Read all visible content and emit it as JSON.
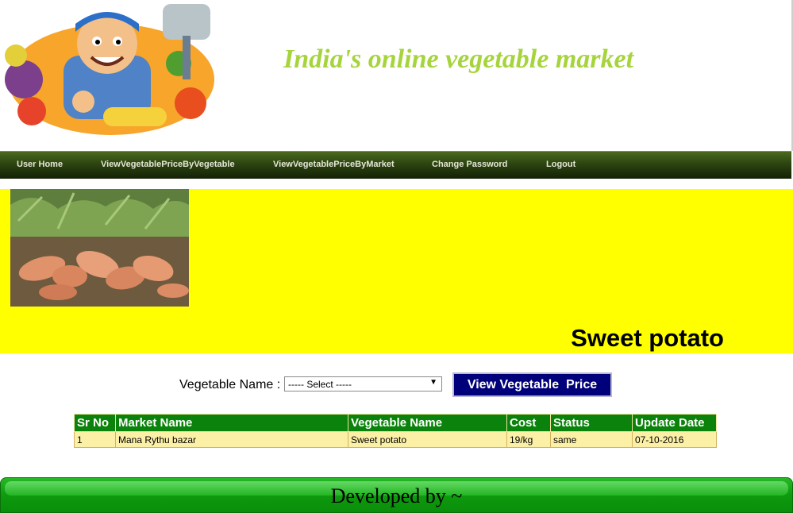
{
  "header": {
    "title": "India's online vegetable market"
  },
  "nav": {
    "items": [
      {
        "label": "User Home"
      },
      {
        "label": "ViewVegetablePriceByVegetable"
      },
      {
        "label": "ViewVegetablePriceByMarket"
      },
      {
        "label": "Change Password"
      },
      {
        "label": "Logout"
      }
    ]
  },
  "banner": {
    "vegetable": "Sweet potato"
  },
  "form": {
    "label": "Vegetable Name :",
    "select_value": "----- Select -----",
    "button_label": "View Vegetable  Price"
  },
  "table": {
    "headers": [
      "Sr No",
      "Market Name",
      "Vegetable Name",
      "Cost",
      "Status",
      "Update Date"
    ],
    "rows": [
      [
        "1",
        "Mana Rythu bazar",
        "Sweet potato",
        "19/kg",
        "same",
        "07-10-2016"
      ]
    ]
  },
  "footer": {
    "text": "Developed by ~"
  },
  "colors": {
    "title": "#a6d43c",
    "banner": "#ffff00",
    "nav": "#2c4410",
    "button": "#00007a",
    "table_header": "#0b820b",
    "table_row": "#fbf0a6",
    "footer": "#0e9a0e"
  }
}
